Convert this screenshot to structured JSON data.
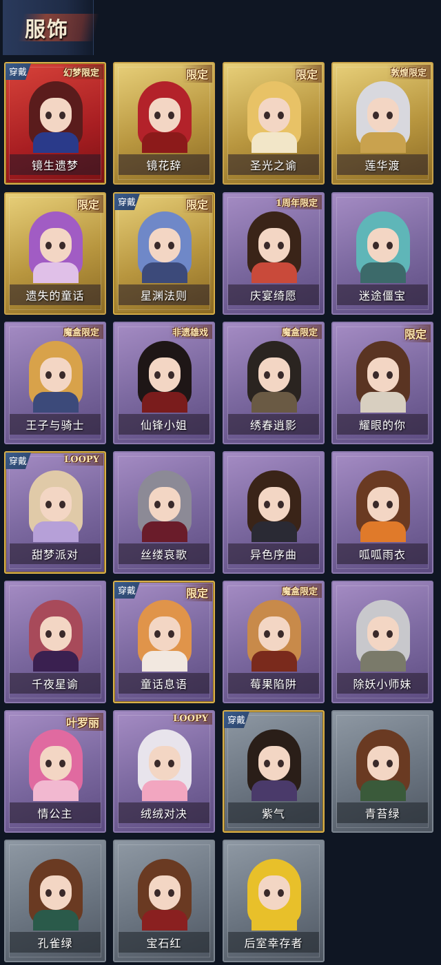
{
  "header": {
    "title": "服饰"
  },
  "equip_label": "穿戴",
  "cards": [
    {
      "name": "镜生遗梦",
      "badge": "幻梦限定",
      "equipped": true,
      "style": "fire",
      "hair": "#5a1c1c",
      "body": "#2a3a8a"
    },
    {
      "name": "镜花辞",
      "badge": "限定",
      "equipped": false,
      "style": "gold",
      "hair": "#b3222a",
      "body": "#8c1a1a"
    },
    {
      "name": "圣光之谕",
      "badge": "限定",
      "equipped": false,
      "style": "gold",
      "hair": "#e8c266",
      "body": "#f2e6c8"
    },
    {
      "name": "莲华渡",
      "badge": "敦煌限定",
      "equipped": false,
      "style": "gold",
      "hair": "#d8d8de",
      "body": "#c9a24e"
    },
    {
      "name": "遗失的童话",
      "badge": "限定",
      "equipped": false,
      "style": "gold",
      "hair": "#a15cc4",
      "body": "#e0c0e8"
    },
    {
      "name": "星渊法则",
      "badge": "限定",
      "equipped": true,
      "style": "gold",
      "hair": "#6f88c8",
      "body": "#3c4a7a"
    },
    {
      "name": "庆宴绮愿",
      "badge": "1周年限定",
      "equipped": false,
      "style": "purple",
      "hair": "#3a2418",
      "body": "#c94a3a"
    },
    {
      "name": "迷途僵宝",
      "badge": "",
      "equipped": false,
      "style": "purple",
      "hair": "#5fb6b8",
      "body": "#3c6a6a"
    },
    {
      "name": "王子与骑士",
      "badge": "魔盒限定",
      "equipped": false,
      "style": "purple",
      "hair": "#d8a24a",
      "body": "#3c4a7a"
    },
    {
      "name": "仙锋小姐",
      "badge": "非遗雄戏",
      "equipped": false,
      "style": "purple",
      "hair": "#1e1616",
      "body": "#7a1c1c"
    },
    {
      "name": "绣春逍影",
      "badge": "魔盒限定",
      "equipped": false,
      "style": "purple",
      "hair": "#2a2420",
      "body": "#6a5a44"
    },
    {
      "name": "耀眼的你",
      "badge": "限定",
      "equipped": false,
      "style": "purple",
      "hair": "#5a3422",
      "body": "#d8cfc0"
    },
    {
      "name": "甜梦派对",
      "badge": "LOOPY",
      "equipped": true,
      "style": "purple",
      "hair": "#e0caa8",
      "body": "#b6a0d8"
    },
    {
      "name": "丝缕哀歌",
      "badge": "",
      "equipped": false,
      "style": "purple",
      "hair": "#8c8a96",
      "body": "#6a1c2a"
    },
    {
      "name": "异色序曲",
      "badge": "",
      "equipped": false,
      "style": "purple",
      "hair": "#3a2418",
      "body": "#2a2a34"
    },
    {
      "name": "呱呱雨衣",
      "badge": "",
      "equipped": false,
      "style": "purple",
      "hair": "#6a3a22",
      "body": "#e07a2a"
    },
    {
      "name": "千夜星谕",
      "badge": "",
      "equipped": false,
      "style": "purple",
      "hair": "#a84a5a",
      "body": "#3a2050"
    },
    {
      "name": "童话息语",
      "badge": "限定",
      "equipped": true,
      "style": "purple",
      "hair": "#e0944a",
      "body": "#f2e8e0"
    },
    {
      "name": "莓果陷阱",
      "badge": "魔盒限定",
      "equipped": false,
      "style": "purple",
      "hair": "#c88a4a",
      "body": "#7a2a1c"
    },
    {
      "name": "除妖小师妹",
      "badge": "",
      "equipped": false,
      "style": "purple",
      "hair": "#c8c8cc",
      "body": "#7a7a6a"
    },
    {
      "name": "情公主",
      "badge": "叶罗丽",
      "equipped": false,
      "style": "purple",
      "hair": "#e06aa0",
      "body": "#f2b8d0"
    },
    {
      "name": "绒绒对决",
      "badge": "LOOPY",
      "equipped": false,
      "style": "purple",
      "hair": "#e8e4ec",
      "body": "#f2a6c0"
    },
    {
      "name": "紫气",
      "badge": "",
      "equipped": true,
      "style": "grey",
      "hair": "#2a1e18",
      "body": "#4a3a6a"
    },
    {
      "name": "青苔绿",
      "badge": "",
      "equipped": false,
      "style": "grey",
      "hair": "#6a3a22",
      "body": "#3a5a3a"
    },
    {
      "name": "孔雀绿",
      "badge": "",
      "equipped": false,
      "style": "grey",
      "hair": "#6a3a22",
      "body": "#2a5a4a"
    },
    {
      "name": "宝石红",
      "badge": "",
      "equipped": false,
      "style": "grey",
      "hair": "#6a3a22",
      "body": "#8a2020"
    },
    {
      "name": "后室幸存者",
      "badge": "",
      "equipped": false,
      "style": "grey",
      "hair": "#e8c02a",
      "body": "#e8c02a"
    }
  ]
}
